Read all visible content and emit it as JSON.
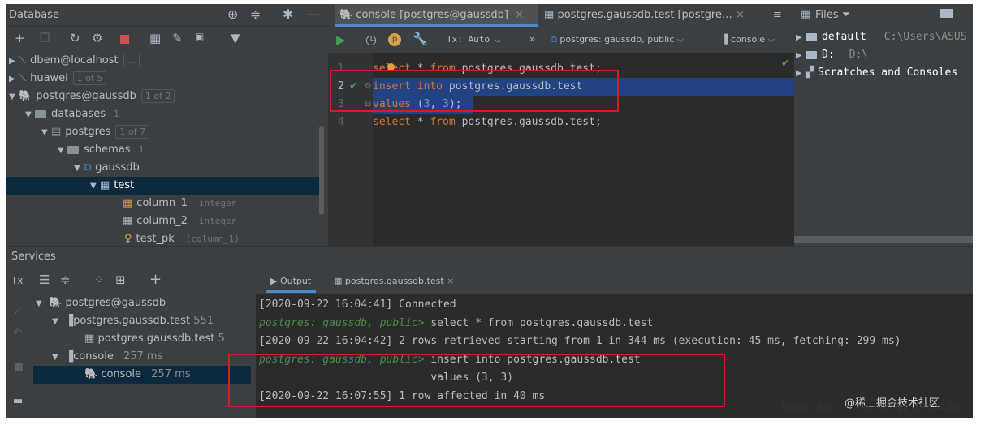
{
  "database_panel": {
    "title": "Database",
    "tree": [
      {
        "label": "dbem@localhost",
        "badge": "..."
      },
      {
        "label": "huawei",
        "badge": "1 of 5"
      },
      {
        "label": "postgres@gaussdb",
        "badge": "1 of 2"
      },
      {
        "label": "databases",
        "badge": "1"
      },
      {
        "label": "postgres",
        "badge": "1 of 7"
      },
      {
        "label": "schemas",
        "badge": "1"
      },
      {
        "label": "gaussdb",
        "badge": ""
      },
      {
        "label": "test",
        "badge": ""
      },
      {
        "label": "column_1",
        "type": "integer"
      },
      {
        "label": "column_2",
        "type": "integer"
      },
      {
        "label": "test_pk",
        "type": "(column_1)"
      }
    ]
  },
  "editor": {
    "tabs": [
      {
        "label": "console [postgres@gaussdb]"
      },
      {
        "label": "postgres.gaussdb.test [postgre…"
      }
    ],
    "toolbar": {
      "tx_label": "Tx: Auto",
      "schema_label": "postgres: gaussdb, public",
      "console_label": "console",
      "more_label": "»"
    },
    "lines": [
      {
        "num": "1",
        "parts": [
          {
            "t": "select",
            "c": "kw"
          },
          {
            "t": " * ",
            "c": ""
          },
          {
            "t": "from",
            "c": "kw"
          },
          {
            "t": " postgres.gaussdb.test;",
            "c": ""
          }
        ]
      },
      {
        "num": "2",
        "parts": [
          {
            "t": "insert",
            "c": "kw"
          },
          {
            "t": " ",
            "c": ""
          },
          {
            "t": "into",
            "c": "kw"
          },
          {
            "t": " postgres.gaussdb.test",
            "c": ""
          }
        ]
      },
      {
        "num": "3",
        "parts": [
          {
            "t": "values",
            "c": "kw"
          },
          {
            "t": " (",
            "c": ""
          },
          {
            "t": "3",
            "c": "num"
          },
          {
            "t": ", ",
            "c": ""
          },
          {
            "t": "3",
            "c": "num"
          },
          {
            "t": ");",
            "c": ""
          }
        ]
      },
      {
        "num": "4",
        "parts": [
          {
            "t": "select",
            "c": "kw"
          },
          {
            "t": " * ",
            "c": ""
          },
          {
            "t": "from",
            "c": "kw"
          },
          {
            "t": " postgres.gaussdb.test;",
            "c": ""
          }
        ]
      }
    ]
  },
  "files_panel": {
    "title": "Files",
    "items": [
      {
        "label": "default",
        "path": "C:\\Users\\ASUS"
      },
      {
        "label": "D:",
        "path": "D:\\"
      },
      {
        "label": "Scratches and Consoles",
        "path": ""
      }
    ]
  },
  "services": {
    "title": "Services",
    "tree": [
      {
        "label": "postgres@gaussdb",
        "extra": ""
      },
      {
        "label": "postgres.gaussdb.test",
        "extra": "551"
      },
      {
        "label": "postgres.gaussdb.test",
        "extra": "5"
      },
      {
        "label": "console",
        "extra": "257 ms"
      },
      {
        "label": "console",
        "extra": "257 ms"
      }
    ],
    "output_tabs": [
      {
        "label": "Output"
      },
      {
        "label": "postgres.gaussdb.test"
      }
    ],
    "output_lines": [
      {
        "prompt": "",
        "text": "[2020-09-22 16:04:41] Connected"
      },
      {
        "prompt": "postgres: gaussdb, public> ",
        "text": "select * from postgres.gaussdb.test"
      },
      {
        "prompt": "",
        "text": "[2020-09-22 16:04:42] 2 rows retrieved starting from 1 in 344 ms (execution: 45 ms, fetching: 299 ms)"
      },
      {
        "prompt": "postgres: gaussdb, public> ",
        "text": "insert into postgres.gaussdb.test"
      },
      {
        "prompt": "",
        "text": "                           values (3, 3)"
      },
      {
        "prompt": "",
        "text": "[2020-09-22 16:07:55] 1 row affected in 40 ms"
      }
    ]
  },
  "watermark": {
    "text": "https://blog.csdn.net/qq_4574450",
    "cn": "@稀土掘金技术社区"
  },
  "colors": {
    "panel": "#3c3f41",
    "editor": "#2b2b2b",
    "selection": "#214283",
    "keyword": "#cc7832",
    "number": "#6897bb",
    "prompt": "#4b8a45",
    "annotation": "#e0181c"
  }
}
